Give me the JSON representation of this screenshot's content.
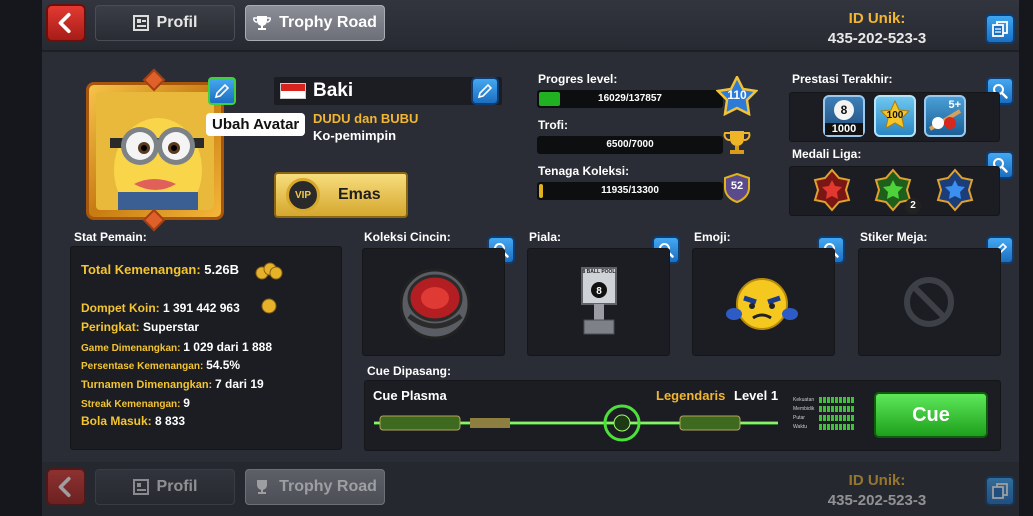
{
  "header": {
    "profile_tab": "Profil",
    "trophy_tab": "Trophy Road",
    "id_label": "ID Unik:",
    "id_value": "435-202-523-3"
  },
  "profile": {
    "name": "Baki",
    "tooltip": "Ubah Avatar",
    "club_name": "DUDU dan BUBU",
    "club_role": "Ko-pemimpin",
    "vip_label": "Emas"
  },
  "progress": {
    "level_label": "Progres level:",
    "level_text": "16029/137857",
    "level_value": 110,
    "level_fraction": 0.116,
    "trophy_label": "Trofi:",
    "trophy_text": "6500/7000",
    "trophy_fraction": 0.0,
    "collection_label": "Tenaga Koleksi:",
    "collection_text": "11935/13300",
    "collection_value": 52,
    "collection_fraction": 0.02
  },
  "achievements": {
    "recent_label": "Prestasi Terakhir:",
    "badges": [
      "1000",
      "100",
      "5+"
    ],
    "league_label": "Medali Liga:",
    "league_count": "2"
  },
  "stats": {
    "title": "Stat Pemain:",
    "total_wins_k": "Total Kemenangan:",
    "total_wins_v": "5.26B",
    "wallet_k": "Dompet Koin:",
    "wallet_v": "1 391 442 963",
    "rank_k": "Peringkat:",
    "rank_v": "Superstar",
    "games_won_k": "Game Dimenangkan:",
    "games_won_v": "1 029 dari 1 888",
    "win_pct_k": "Persentase Kemenangan:",
    "win_pct_v": "54.5%",
    "tourn_k": "Turnamen Dimenangkan:",
    "tourn_v": "7 dari 19",
    "streak_k": "Streak Kemenangan:",
    "streak_v": "9",
    "balls_k": "Bola Masuk:",
    "balls_v": "8 833"
  },
  "collections": {
    "rings_label": "Koleksi Cincin:",
    "trophy_label": "Piala:",
    "trophy_plaque": "8 BALL POOL",
    "emoji_label": "Emoji:",
    "sticker_label": "Stiker Meja:"
  },
  "cue": {
    "section_label": "Cue Dipasang:",
    "name": "Cue Plasma",
    "rarity": "Legendaris",
    "level": "Level 1",
    "stats": [
      "Kekuatan",
      "Membidik",
      "Putar",
      "Waktu"
    ],
    "button": "Cue"
  }
}
